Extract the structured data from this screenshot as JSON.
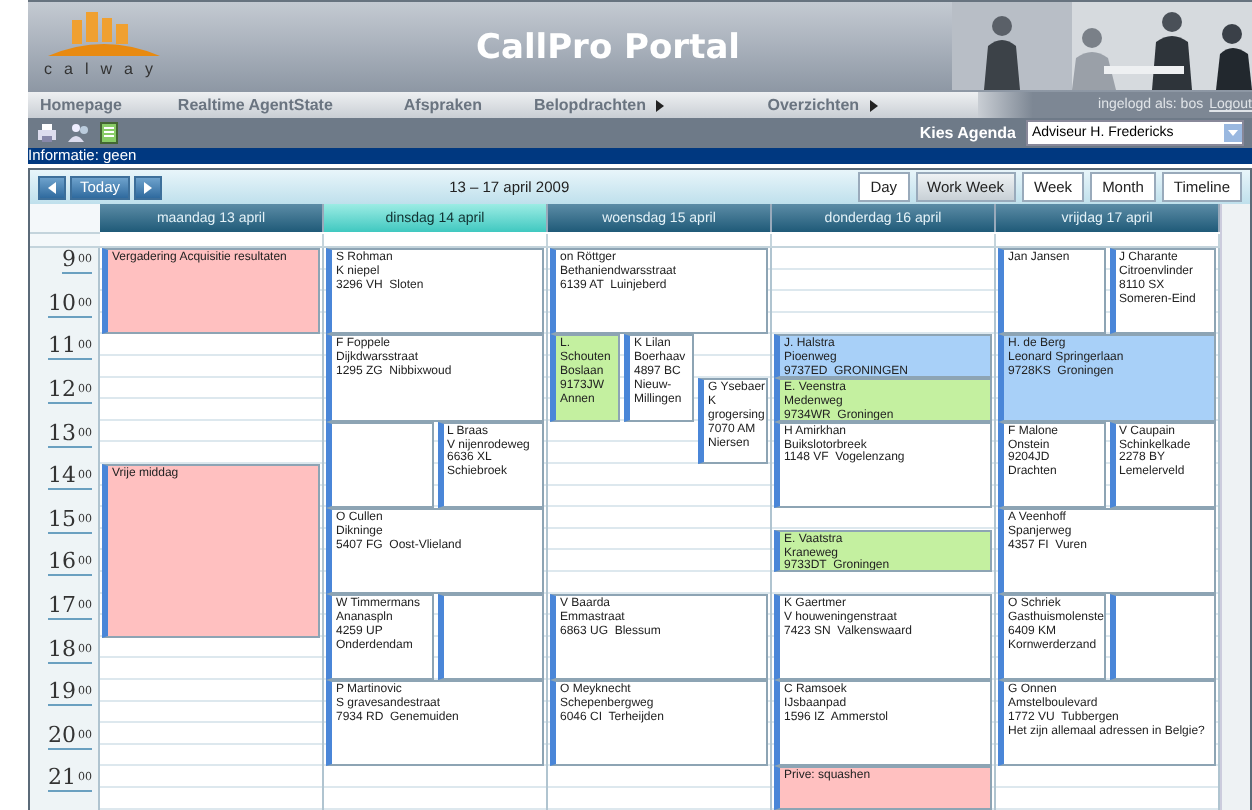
{
  "header": {
    "logo_text": "calway",
    "title": "CallPro Portal"
  },
  "nav": {
    "items": [
      {
        "label": "Homepage",
        "submenu": false
      },
      {
        "label": "Realtime AgentState",
        "submenu": false
      },
      {
        "label": "Afspraken",
        "submenu": false
      },
      {
        "label": "Belopdrachten",
        "submenu": true
      },
      {
        "label": "Overzichten",
        "submenu": true
      }
    ],
    "login": "ingelogd als: bos",
    "logout": "Logout"
  },
  "toolbar": {
    "agenda_label": "Kies Agenda",
    "agenda_value": "Adviseur H. Fredericks"
  },
  "info": "Informatie: geen",
  "calendar": {
    "today": "Today",
    "range": "13 – 17 april 2009",
    "views": [
      {
        "label": "Day",
        "selected": false
      },
      {
        "label": "Work Week",
        "selected": true
      },
      {
        "label": "Week",
        "selected": false
      },
      {
        "label": "Month",
        "selected": false
      },
      {
        "label": "Timeline",
        "selected": false
      }
    ],
    "hours": [
      {
        "hour": "9",
        "minutes": "00"
      },
      {
        "hour": "10",
        "minutes": "00"
      },
      {
        "hour": "11",
        "minutes": "00"
      },
      {
        "hour": "12",
        "minutes": "00"
      },
      {
        "hour": "13",
        "minutes": "00"
      },
      {
        "hour": "14",
        "minutes": "00"
      },
      {
        "hour": "15",
        "minutes": "00"
      },
      {
        "hour": "16",
        "minutes": "00"
      },
      {
        "hour": "17",
        "minutes": "00"
      },
      {
        "hour": "18",
        "minutes": "00"
      },
      {
        "hour": "19",
        "minutes": "00"
      },
      {
        "hour": "20",
        "minutes": "00"
      },
      {
        "hour": "21",
        "minutes": "00"
      }
    ],
    "days": [
      {
        "label": "maandag 13 april",
        "selected": false,
        "events": [
          {
            "color": "#ffc0c0",
            "lines": [
              "Vergadering Acquisitie resultaten"
            ]
          },
          {
            "color": "#ffc0c0",
            "lines": [
              "Vrije middag"
            ]
          }
        ]
      },
      {
        "label": "dinsdag 14 april",
        "selected": true,
        "events": [
          {
            "color": "#ffffff",
            "lines": [
              "S Rohman",
              "K niepel",
              "3296 VH  Sloten"
            ]
          },
          {
            "color": "#ffffff",
            "lines": [
              "F Foppele",
              "Dijkdwarsstraat",
              "1295 ZG  Nibbixwoud"
            ]
          },
          {
            "color": "#ffffff"
          },
          {
            "color": "#ffffff",
            "lines": [
              "L Braas",
              "V nijenrodeweg",
              "6636 XL",
              "Schiebroek"
            ]
          },
          {
            "color": "#ffffff",
            "lines": [
              "O Cullen",
              "Dikninge",
              "5407 FG  Oost-Vlieland"
            ]
          },
          {
            "color": "#ffffff",
            "lines": [
              "W Timmermans",
              "Ananaspln",
              "4259 UP",
              "Onderdendam"
            ]
          },
          {
            "color": "#ffffff"
          },
          {
            "color": "#ffffff",
            "lines": [
              "P Martinovic",
              "S gravesandestraat",
              "7934 RD  Genemuiden"
            ]
          }
        ]
      },
      {
        "label": "woensdag 15 april",
        "selected": false,
        "events": [
          {
            "color": "#ffffff",
            "lines": [
              "on Röttger",
              "Bethaniendwarsstraat",
              "6139 AT  Luinjeberd"
            ]
          },
          {
            "color": "#c4f0a0",
            "lines": [
              "L.",
              "Schouten",
              "Boslaan",
              "9173JW",
              "Annen"
            ]
          },
          {
            "color": "#ffffff",
            "lines": [
              "K Lilan",
              "Boerhaav",
              "4897 BC",
              "Nieuw-",
              "Millingen"
            ]
          },
          {
            "color": "#ffffff",
            "lines": [
              "G Ysebaer",
              "K",
              "grogersing",
              "7070 AM",
              "Niersen"
            ]
          },
          {
            "color": "#ffffff",
            "lines": [
              "V Baarda",
              "Emmastraat",
              "6863 UG  Blessum"
            ]
          },
          {
            "color": "#ffffff",
            "lines": [
              "O Meyknecht",
              "Schepenbergweg",
              "6046 CI  Terheijden"
            ]
          }
        ]
      },
      {
        "label": "donderdag 16 april",
        "selected": false,
        "events": [
          {
            "color": "#a8d0f8",
            "lines": [
              "J. Halstra",
              "Pioenweg",
              "9737ED  GRONINGEN"
            ]
          },
          {
            "color": "#c4f0a0",
            "lines": [
              "E. Veenstra",
              "Medenweg",
              "9734WR  Groningen"
            ]
          },
          {
            "color": "#ffffff",
            "lines": [
              "H Amirkhan",
              "Buikslotorbreek",
              "1148 VF  Vogelenzang"
            ]
          },
          {
            "color": "#c4f0a0",
            "lines": [
              "E. Vaatstra",
              "Kraneweg",
              "9733DT  Groningen"
            ]
          },
          {
            "color": "#ffffff",
            "lines": [
              "K Gaertmer",
              "V houweningenstraat",
              "7423 SN  Valkenswaard"
            ]
          },
          {
            "color": "#ffffff",
            "lines": [
              "C Ramsoek",
              "IJsbaanpad",
              "1596 IZ  Ammerstol"
            ]
          },
          {
            "color": "#ffc0c0",
            "lines": [
              "Prive: squashen"
            ]
          }
        ]
      },
      {
        "label": "vrijdag 17 april",
        "selected": false,
        "events": [
          {
            "color": "#ffffff",
            "lines": [
              "Jan Jansen"
            ]
          },
          {
            "color": "#ffffff",
            "lines": [
              "J Charante",
              "Citroenvlinder",
              "8110 SX",
              "Someren-Eind"
            ]
          },
          {
            "color": "#a8d0f8",
            "lines": [
              "H. de Berg",
              "Leonard Springerlaan",
              "9728KS  Groningen"
            ]
          },
          {
            "color": "#ffffff",
            "lines": [
              "F Malone",
              "Onstein",
              "9204JD",
              "Drachten"
            ]
          },
          {
            "color": "#ffffff",
            "lines": [
              "V Caupain",
              "Schinkelkade",
              "2278 BY",
              "Lemelerveld"
            ]
          },
          {
            "color": "#ffffff",
            "lines": [
              "A Veenhoff",
              "Spanjerweg",
              "4357 FI  Vuren"
            ]
          },
          {
            "color": "#ffffff",
            "lines": [
              "O Schriek",
              "Gasthuismolenste",
              "6409 KM",
              "Kornwerderzand"
            ]
          },
          {
            "color": "#ffffff"
          },
          {
            "color": "#ffffff",
            "lines": [
              "G Onnen",
              "Amstelboulevard",
              "1772 VU  Tubbergen",
              "Het zijn allemaal adressen in Belgie?"
            ]
          }
        ]
      }
    ]
  }
}
